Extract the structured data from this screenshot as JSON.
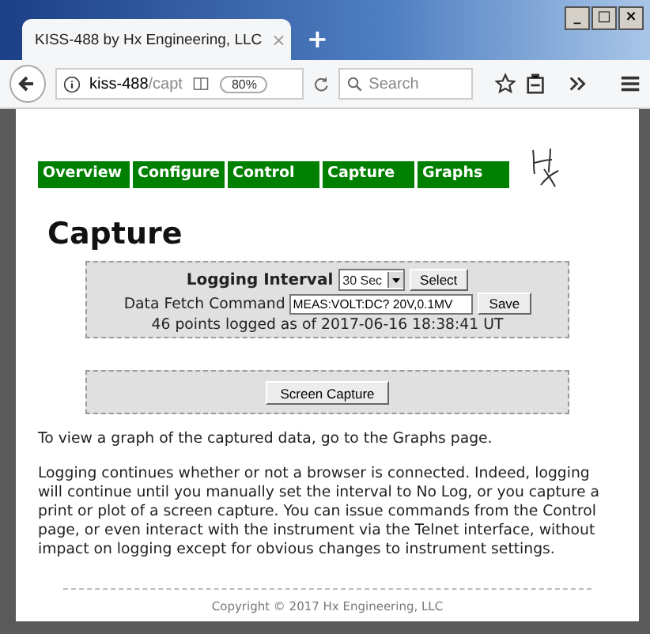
{
  "browser": {
    "tab_title": "KISS-488 by Hx Engineering, LLC",
    "tab_close": "×",
    "new_tab": "+",
    "url_host": "kiss-488",
    "url_path": "/capt",
    "zoom": "80%",
    "search_placeholder": "Search",
    "window_buttons": [
      "_",
      "□",
      "×"
    ]
  },
  "nav": [
    {
      "label": "Overview",
      "selected": false
    },
    {
      "label": "Configure",
      "selected": false
    },
    {
      "label": "Control",
      "selected": false
    },
    {
      "label": "Capture",
      "selected": false
    },
    {
      "label": "Graphs",
      "selected": false
    }
  ],
  "heading": "Capture",
  "logging": {
    "label": "Logging Interval",
    "interval": "30 Sec",
    "select_button": "Select",
    "fetch_label": "Data Fetch Command",
    "fetch_value": "MEAS:VOLT:DC? 20V,0.1MV",
    "save_button": "Save",
    "status": "46 points logged as of 2017-06-16 18:38:41 UT"
  },
  "screen_capture_button": "Screen Capture",
  "paragraphs": [
    "To view a graph of the captured data, go to the Graphs page.",
    "Logging continues whether or not a browser is connected. Indeed, logging will continue until you manually set the interval to No Log, or you capture a print or plot of a screen capture. You can issue commands from the Control page, or even interact with the instrument via the Telnet interface, without impact on logging except for obvious changes to instrument settings."
  ],
  "footer": "Copyright © 2017 Hx Engineering, LLC"
}
